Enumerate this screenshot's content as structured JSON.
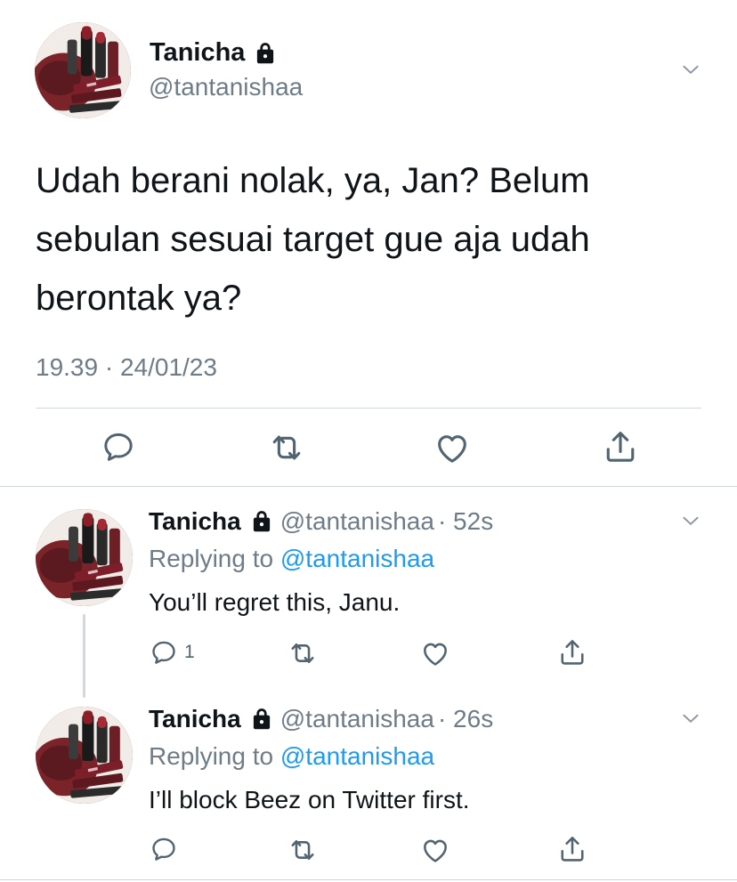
{
  "main_tweet": {
    "display_name": "Tanicha",
    "handle": "@tantanishaa",
    "text_lines": [
      "Udah berani nolak, ya, Jan? Belum",
      "sebulan sesuai target gue aja udah",
      "berontak ya?"
    ],
    "timestamp": "19.39 · 24/01/23",
    "actions": [
      "reply-icon",
      "retweet-icon",
      "like-icon",
      "share-icon"
    ]
  },
  "replies": [
    {
      "display_name": "Tanicha",
      "handle": "@tantanishaa",
      "time": "· 52s",
      "replying_label": "Replying to",
      "replying_handle": "@tantanishaa",
      "text": "You’ll regret this, Janu.",
      "reply_count": "1"
    },
    {
      "display_name": "Tanicha",
      "handle": "@tantanishaa",
      "time": "· 26s",
      "replying_label": "Replying to",
      "replying_handle": "@tantanishaa",
      "text": "I’ll block Beez on Twitter first.",
      "reply_count": ""
    }
  ],
  "colors": {
    "link": "#1d9bf0",
    "muted": "#6e7c87",
    "text": "#0f1419",
    "divider": "#d0d6db"
  }
}
